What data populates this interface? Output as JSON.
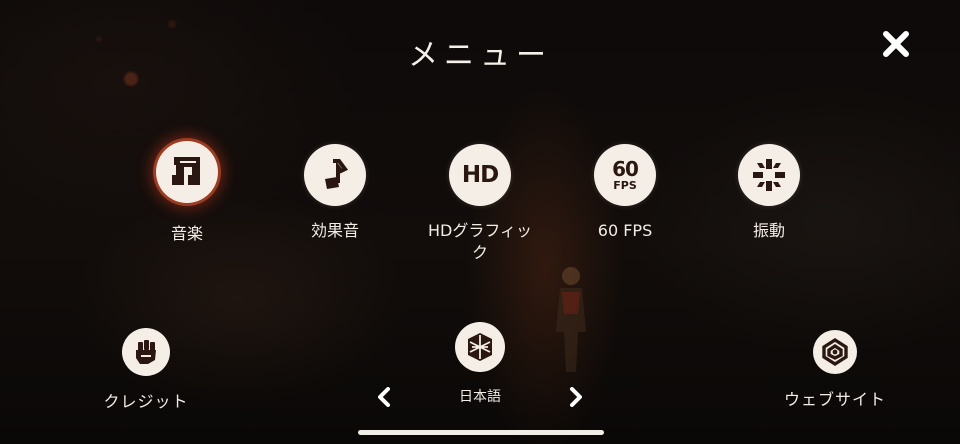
{
  "menu": {
    "title": "メニュー",
    "close_icon": "close-icon"
  },
  "options": [
    {
      "id": "music",
      "label": "音楽",
      "icon": "music-note-icon",
      "selected": true
    },
    {
      "id": "sfx",
      "label": "効果音",
      "icon": "note-icon",
      "selected": false
    },
    {
      "id": "hd",
      "label": "HDグラフィック",
      "icon": "hd-icon",
      "icon_text": "HD",
      "selected": false
    },
    {
      "id": "fps",
      "label": "60 FPS",
      "icon": "fps-icon",
      "icon_text_top": "60",
      "icon_text_bottom": "FPS",
      "selected": false
    },
    {
      "id": "vibration",
      "label": "振動",
      "icon": "vibration-icon",
      "selected": false
    }
  ],
  "bottom": {
    "credits": {
      "label": "クレジット",
      "icon": "fist-icon"
    },
    "language": {
      "label": "日本語",
      "icon": "globe-icon",
      "prev_icon": "chevron-left-icon",
      "next_icon": "chevron-right-icon"
    },
    "website": {
      "label": "ウェブサイト",
      "icon": "website-icon"
    }
  },
  "colors": {
    "badge": "#f4eee6",
    "icon_dark": "#2a1712",
    "active_glow": "#c83c1e"
  }
}
